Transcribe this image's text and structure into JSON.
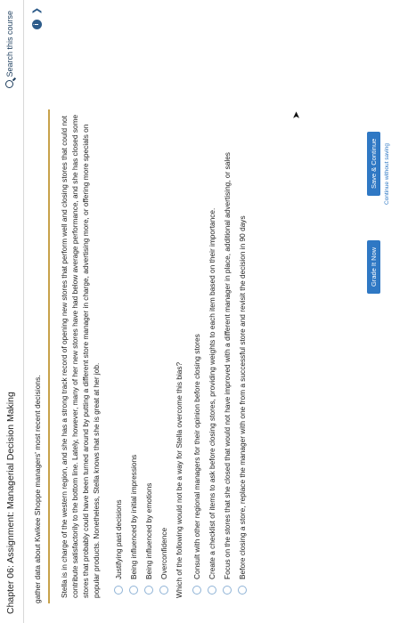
{
  "header": {
    "title": "Chapter 06: Assignment: Managerial Decision Making",
    "search_placeholder": "Search this course"
  },
  "intro": "gather data about Kwikee Shoppe managers' most recent decisions.",
  "scenario": "Stella is in charge of the western region, and she has a strong track record of opening new stores that perform well and closing stores that could not contribute satisfactorily to the bottom line. Lately, however, many of her new stores have had below average performance, and she has closed some stores that probably could have been turned around by putting a different store manager in charge, advertising more, or offering more specials on popular products. Nonetheless, Stella knows that she is great at her job.",
  "options_1": [
    "Justifying past decisions",
    "Being influenced by initial impressions",
    "Being influenced by emotions",
    "Overconfidence"
  ],
  "question": "Which of the following would not be a way for Stella overcome this bias?",
  "options_2": [
    "Consult with other regional managers for their opinion before closing stores",
    "Create a checklist of items to ask before closing stores, providing weights to each item based on their importance.",
    "Focus on the stores that she closed that would not have improved with a different manager in place, additional advertising, or sales",
    "Before closing a store, replace the manager with one from a successful store and revisit the decision in 90 days"
  ],
  "buttons": {
    "grade": "Grade It Now",
    "save": "Save & Continue",
    "continue_link": "Continue without saving"
  },
  "icons": {
    "search": "search-icon",
    "info": "info-icon",
    "next": "chevron-right-icon"
  },
  "colors": {
    "accent": "#2f78c4",
    "rule": "#c8a24a"
  }
}
